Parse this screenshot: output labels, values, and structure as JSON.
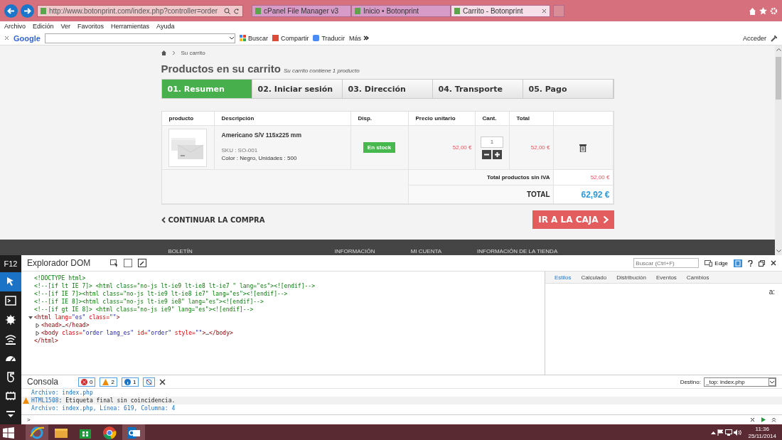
{
  "browser": {
    "address": "http://www.botonprint.com/index.php?controller=order",
    "tabs": [
      {
        "title": "cPanel File Manager v3",
        "selected": false
      },
      {
        "title": "Inicio • Botonprint",
        "selected": false
      },
      {
        "title": "Carrito - Botonprint",
        "selected": true
      }
    ],
    "menu": [
      "Archivo",
      "Edición",
      "Ver",
      "Favoritos",
      "Herramientas",
      "Ayuda"
    ],
    "toolbar": {
      "logo": "Google",
      "search_button": "Buscar",
      "share_button": "Compartir",
      "translate_button": "Traducir",
      "more_button": "Más",
      "signin": "Acceder"
    }
  },
  "page": {
    "breadcrumb": "Su carrito",
    "heading": "Productos en su carrito",
    "subheading": "Su carrito contiene 1 producto",
    "steps": [
      {
        "label": "01. Resumen",
        "selected": true
      },
      {
        "label": "02. Iniciar sesión",
        "selected": false
      },
      {
        "label": "03. Dirección",
        "selected": false
      },
      {
        "label": "04. Transporte",
        "selected": false
      },
      {
        "label": "05. Pago",
        "selected": false
      }
    ],
    "columns": [
      "producto",
      "Descripción",
      "Disp.",
      "Precio unitario",
      "Cant.",
      "Total"
    ],
    "item": {
      "name": "Americano S/V 115x225 mm",
      "sku": "SKU : SO-001",
      "attributes": "Color : Negro, Unidades : 500",
      "availability": "En stock",
      "unit_price": "52,00 €",
      "quantity": "1",
      "total": "52,00 €"
    },
    "subtotal_label": "Total productos sin IVA",
    "subtotal": "52,00 €",
    "total_label": "TOTAL",
    "total": "62,92 €",
    "continue_link": "CONTINUAR LA COMPRA",
    "checkout_button": "IR A LA CAJA",
    "footer_headings": [
      "BOLETÍN",
      "INFORMACIÓN",
      "MI CUENTA",
      "INFORMACIÓN DE LA TIENDA"
    ]
  },
  "devtools": {
    "label": "F12",
    "tools": [
      {
        "kind": "pointer",
        "selected": true
      },
      {
        "kind": "console",
        "selected": false
      },
      {
        "kind": "debugger",
        "selected": false
      },
      {
        "kind": "network",
        "selected": false
      },
      {
        "kind": "performance",
        "selected": false
      },
      {
        "kind": "memory",
        "selected": false
      },
      {
        "kind": "emulation",
        "selected": false
      },
      {
        "kind": "more",
        "selected": false
      }
    ],
    "dom_title": "Explorador DOM",
    "search_placeholder": "Buscar (Ctrl+F)",
    "mode": "Edge",
    "dom": [
      {
        "segments": [
          {
            "kind": "comment",
            "text": "<!DOCTYPE html>"
          }
        ]
      },
      {
        "segments": [
          {
            "kind": "comment",
            "text": "<!--[if lt IE 7]> <html class=\"no-js lt-ie9 lt-ie8 lt-ie7 \" lang=\"es\"><![endif]-->"
          }
        ]
      },
      {
        "segments": [
          {
            "kind": "comment",
            "text": "<!--[if IE 7]><html class=\"no-js lt-ie9 lt-ie8 ie7\" lang=\"es\"><![endif]-->"
          }
        ]
      },
      {
        "segments": [
          {
            "kind": "comment",
            "text": "<!--[if IE 8]><html class=\"no-js lt-ie9 ie8\" lang=\"es\"><![endif]-->"
          }
        ]
      },
      {
        "segments": [
          {
            "kind": "comment",
            "text": "<!--[if gt IE 8]> <html class=\"no-js ie9\" lang=\"es\"><![endif]-->"
          }
        ]
      },
      {
        "expanded": true,
        "segments": [
          {
            "kind": "tag",
            "text": "<html "
          },
          {
            "kind": "attr",
            "text": "lang="
          },
          {
            "kind": "value",
            "text": "\"es\""
          },
          {
            "kind": "attr",
            "text": " class="
          },
          {
            "kind": "value",
            "text": "\"\""
          },
          {
            "kind": "tag",
            "text": ">"
          }
        ],
        "children": [
          {
            "expanded": false,
            "segments": [
              {
                "kind": "tag",
                "text": "<head>"
              },
              {
                "kind": "plain",
                "text": "…"
              },
              {
                "kind": "tag",
                "text": "</head>"
              }
            ]
          },
          {
            "expanded": false,
            "segments": [
              {
                "kind": "tag",
                "text": "<body "
              },
              {
                "kind": "attr",
                "text": "class="
              },
              {
                "kind": "value",
                "text": "\"order lang_es\""
              },
              {
                "kind": "attr",
                "text": " id="
              },
              {
                "kind": "value",
                "text": "\"order\""
              },
              {
                "kind": "attr",
                "text": " style="
              },
              {
                "kind": "value",
                "text": "\"\""
              },
              {
                "kind": "tag",
                "text": ">"
              },
              {
                "kind": "plain",
                "text": "…"
              },
              {
                "kind": "tag",
                "text": "</body>"
              }
            ]
          }
        ],
        "close": "</html>"
      }
    ],
    "style_tabs": [
      {
        "label": "Estilos",
        "selected": true
      },
      {
        "label": "Calculado",
        "selected": false
      },
      {
        "label": "Distribución",
        "selected": false
      },
      {
        "label": "Eventos",
        "selected": false
      },
      {
        "label": "Cambios",
        "selected": false
      }
    ],
    "style_hint": "a:",
    "console": {
      "title": "Consola",
      "errors": "0",
      "warnings": "2",
      "info": "1",
      "target_label": "Destino:",
      "target": "_top: index.php",
      "messages": [
        {
          "kind": "file",
          "text": "Archivo: index.php"
        },
        {
          "kind": "warning",
          "code": "HTML1508",
          "text": ": Etiqueta final sin coincidencia."
        },
        {
          "kind": "file",
          "text": "Archivo: index.php, Línea: 619, Columna: 4"
        }
      ],
      "prompt": ">"
    }
  },
  "taskbar": {
    "apps": [
      {
        "kind": "ie",
        "selected": true
      },
      {
        "kind": "explorer",
        "selected": false
      },
      {
        "kind": "store",
        "selected": false
      },
      {
        "kind": "chrome",
        "selected": false
      },
      {
        "kind": "outlook",
        "selected": true
      }
    ],
    "time": "11:36",
    "date": "25/11/2014"
  }
}
